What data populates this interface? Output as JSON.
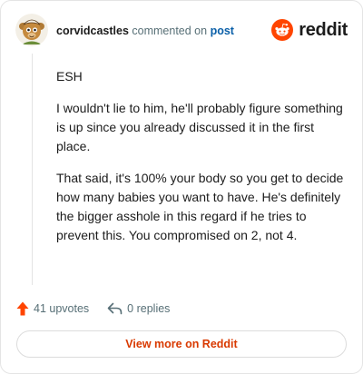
{
  "header": {
    "username": "corvidcastles",
    "action": "commented on",
    "target": "post",
    "brand": "reddit",
    "avatar_icon": "mascot-avatar-icon",
    "brand_icon": "reddit-snoo-icon"
  },
  "comment": {
    "paragraphs": [
      "ESH",
      "I wouldn't lie to him, he'll probably figure something is up since you already discussed it in the first place.",
      "That said, it's 100% your body so you get to decide how many babies you want to have. He's definitely the bigger asshole in this regard if he tries to prevent this. You compromised on 2, not 4."
    ]
  },
  "footer": {
    "upvotes": "41 upvotes",
    "replies": "0 replies",
    "upvote_icon": "upvote-arrow-icon",
    "reply_icon": "reply-icon"
  },
  "cta": {
    "label": "View more on Reddit"
  },
  "colors": {
    "brand": "#ff4500",
    "cta_text": "#d93900",
    "link": "#0a5fa8",
    "muted": "#576f76",
    "border": "#e4e4e4"
  }
}
